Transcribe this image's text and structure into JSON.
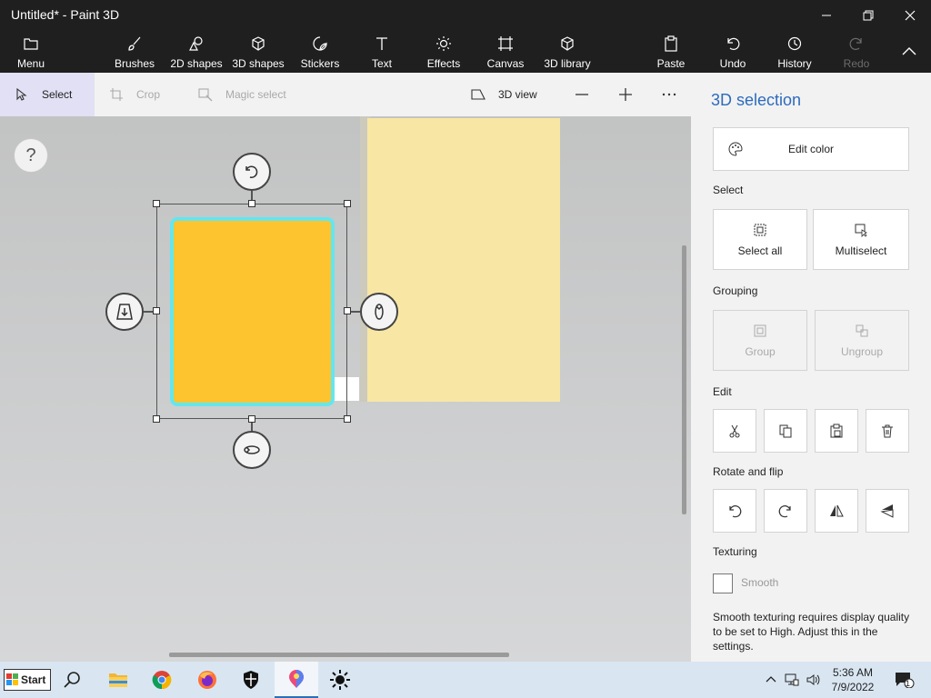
{
  "window": {
    "title": "Untitled* - Paint 3D"
  },
  "ribbon": {
    "menu": "Menu",
    "brushes": "Brushes",
    "shapes2d": "2D shapes",
    "shapes3d": "3D shapes",
    "stickers": "Stickers",
    "text": "Text",
    "effects": "Effects",
    "canvas": "Canvas",
    "library3d": "3D library",
    "paste": "Paste",
    "undo": "Undo",
    "history": "History",
    "redo": "Redo"
  },
  "toolbar": {
    "select": "Select",
    "crop": "Crop",
    "magic_select": "Magic select",
    "view3d": "3D view"
  },
  "canvas": {
    "help": "?"
  },
  "panel": {
    "title": "3D selection",
    "edit_color": "Edit color",
    "select_section": "Select",
    "select_all": "Select all",
    "multiselect": "Multiselect",
    "grouping_section": "Grouping",
    "group": "Group",
    "ungroup": "Ungroup",
    "edit_section": "Edit",
    "rotate_section": "Rotate and flip",
    "texturing_section": "Texturing",
    "smooth": "Smooth",
    "smooth_note": "Smooth texturing requires display quality to be set to High. Adjust this in the settings."
  },
  "taskbar": {
    "start": "Start",
    "time": "5:36 AM",
    "date": "7/9/2022",
    "notification_count": "1"
  },
  "colors": {
    "accent": "#2d6bbd",
    "shape_fill": "#fdc430",
    "shape_outline": "#62e7f0",
    "paper": "#f8e6a4"
  }
}
